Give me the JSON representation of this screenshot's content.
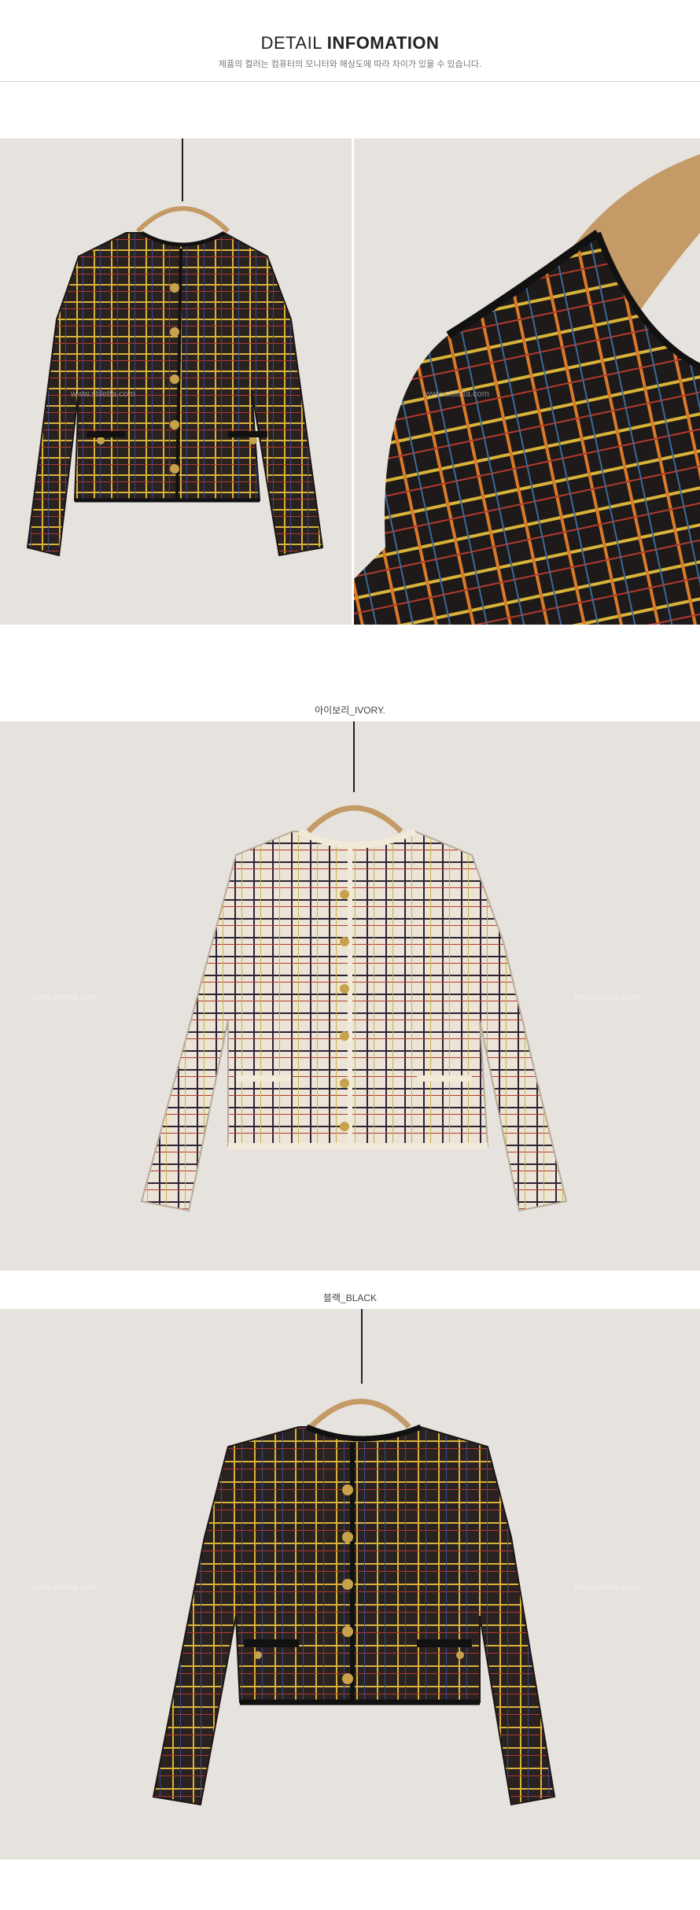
{
  "header": {
    "title_light": "DETAIL ",
    "title_bold": "INFOMATION",
    "subtitle": "제품의 컬러는 컴퓨터의 모니터와 해상도에 따라 차이가 있을 수 있습니다."
  },
  "watermark": "www.stiletta.com",
  "sections": {
    "ivory_label": "아이보리_IVORY.",
    "black_label": "블랙_BLACK"
  },
  "colors": {
    "backdrop": "#e6e2de",
    "black_fabric": "#2a2220",
    "ivory_fabric": "#ece4d6",
    "check_yellow": "#d9b23a",
    "check_dark": "#2b2236",
    "check_red": "#b33a2e",
    "trim_cream": "#f2ead8",
    "button_gold": "#c8a24a"
  }
}
